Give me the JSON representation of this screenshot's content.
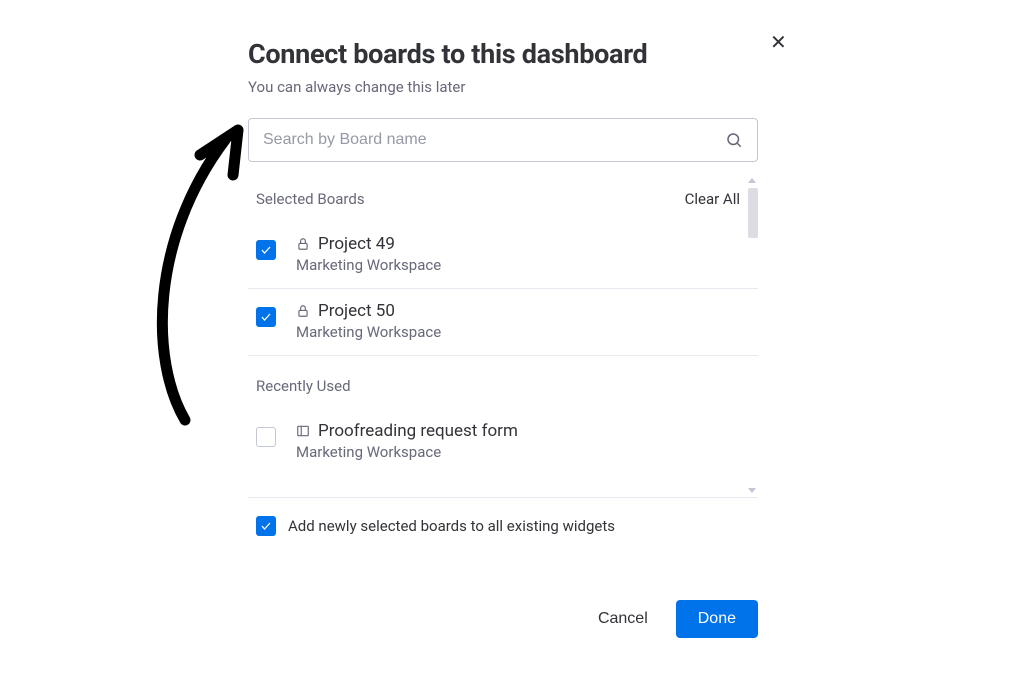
{
  "header": {
    "title": "Connect boards to this dashboard",
    "subtitle": "You can always change this later"
  },
  "search": {
    "placeholder": "Search by Board name",
    "value": ""
  },
  "sections": {
    "selected_label": "Selected Boards",
    "clear_all": "Clear All",
    "recently_label": "Recently Used"
  },
  "selected_boards": [
    {
      "name": "Project 49",
      "workspace": "Marketing Workspace",
      "icon": "lock",
      "checked": true
    },
    {
      "name": "Project 50",
      "workspace": "Marketing Workspace",
      "icon": "lock",
      "checked": true
    }
  ],
  "recently_used": [
    {
      "name": "Proofreading request form",
      "workspace": "Marketing Workspace",
      "icon": "board",
      "checked": false
    }
  ],
  "footer_option": {
    "label": "Add newly selected boards to all existing widgets",
    "checked": true
  },
  "actions": {
    "cancel": "Cancel",
    "done": "Done"
  },
  "colors": {
    "primary": "#0073ea"
  }
}
